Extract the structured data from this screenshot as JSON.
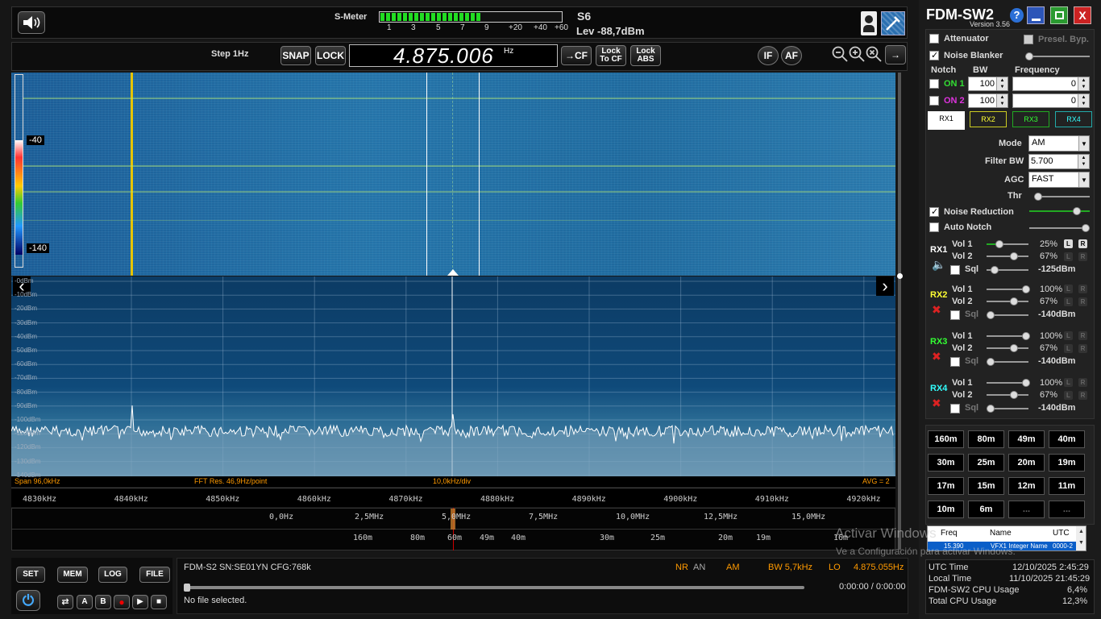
{
  "smeter": {
    "label": "S-Meter",
    "scale": [
      "1",
      "3",
      "5",
      "7",
      "9",
      "+20",
      "+40",
      "+60"
    ],
    "s_value": "S6",
    "level": "Lev -88,7dBm",
    "fill_fraction": 0.55
  },
  "toolbar": {
    "step": "Step 1Hz",
    "snap": "SNAP",
    "lock": "LOCK",
    "frequency": "4.875.006",
    "freq_unit": "Hz",
    "cf": "CF",
    "lock_to_cf": "Lock To CF",
    "lock_abs": "Lock ABS",
    "if": "IF",
    "af": "AF"
  },
  "waterfall": {
    "scale_top": "-40",
    "scale_bottom": "-140"
  },
  "spectrum": {
    "db_labels": [
      "-0dBm",
      "-10dBm",
      "-20dBm",
      "-30dBm",
      "-40dBm",
      "-50dBm",
      "-60dBm",
      "-70dBm",
      "-80dBm",
      "-90dBm",
      "-100dBm",
      "-110dBm",
      "-120dBm",
      "-130dBm",
      "-140dBm"
    ],
    "span": "Span 96,0kHz",
    "fft_res": "FFT Res. 46,9Hz/point",
    "div": "10,0kHz/div",
    "avg": "AVG = 2"
  },
  "freq_scale": [
    "4830kHz",
    "4840kHz",
    "4850kHz",
    "4860kHz",
    "4870kHz",
    "4880kHz",
    "4890kHz",
    "4900kHz",
    "4910kHz",
    "4920kHz"
  ],
  "hz_scale": [
    "0,0Hz",
    "2,5MHz",
    "5,0MHz",
    "7,5MHz",
    "10,0MHz",
    "12,5MHz",
    "15,0MHz"
  ],
  "band_scale": [
    "160m",
    "80m",
    "60m",
    "49m",
    "40m",
    "30m",
    "25m",
    "20m",
    "19m",
    "16m"
  ],
  "bottom_buttons": {
    "set": "SET",
    "mem": "MEM",
    "log": "LOG",
    "file": "FILE",
    "a": "A",
    "b": "B"
  },
  "status": {
    "device": "FDM-S2  SN:SE01YN  CFG:768k",
    "nr": "NR",
    "an": "AN",
    "mode": "AM",
    "bw": "BW 5,7kHz",
    "lo": "LO",
    "lo_freq": "4.875.055Hz",
    "file": "No file selected.",
    "time": "0:00:00 / 0:00:00"
  },
  "app": {
    "title": "FDM-SW2",
    "version": "Version 3.56"
  },
  "panel": {
    "attenuator": "Attenuator",
    "presel": "Presel. Byp.",
    "noise_blanker": "Noise Blanker",
    "notch": "Notch",
    "bw": "BW",
    "frequency": "Frequency",
    "on1": "ON 1",
    "on2": "ON 2",
    "n1_bw": "100",
    "n2_bw": "100",
    "n1_freq": "0",
    "n2_freq": "0",
    "rx_tabs": [
      "RX1",
      "RX2",
      "RX3",
      "RX4"
    ],
    "mode_label": "Mode",
    "mode_value": "AM",
    "filter_bw_label": "Filter BW",
    "filter_bw_value": "5.700",
    "agc_label": "AGC",
    "agc_value": "FAST",
    "thr_label": "Thr",
    "noise_reduction": "Noise Reduction",
    "auto_notch": "Auto Notch"
  },
  "rx": [
    {
      "name": "RX1",
      "vol1": "Vol 1",
      "vol1_val": "25%",
      "vol2": "Vol 2",
      "vol2_val": "67%",
      "sql": "Sql",
      "sql_val": "-125dBm",
      "color": "#ffffff"
    },
    {
      "name": "RX2",
      "vol1": "Vol 1",
      "vol1_val": "100%",
      "vol2": "Vol 2",
      "vol2_val": "67%",
      "sql": "Sql",
      "sql_val": "-140dBm",
      "color": "#ffff33"
    },
    {
      "name": "RX3",
      "vol1": "Vol 1",
      "vol1_val": "100%",
      "vol2": "Vol 2",
      "vol2_val": "67%",
      "sql": "Sql",
      "sql_val": "-140dBm",
      "color": "#33ff33"
    },
    {
      "name": "RX4",
      "vol1": "Vol 1",
      "vol1_val": "100%",
      "vol2": "Vol 2",
      "vol2_val": "67%",
      "sql": "Sql",
      "sql_val": "-140dBm",
      "color": "#33ffff"
    }
  ],
  "lr": {
    "l": "L",
    "r": "R"
  },
  "bands": [
    "160m",
    "80m",
    "49m",
    "40m",
    "30m",
    "25m",
    "20m",
    "19m",
    "17m",
    "15m",
    "12m",
    "11m",
    "10m",
    "6m",
    "...",
    "..."
  ],
  "memlist": {
    "freq": "Freq",
    "name": "Name",
    "utc": "UTC",
    "row_freq": "15.390",
    "row_name": "VFX1 Integer Name",
    "row_utc": "0000-2"
  },
  "activation": {
    "title": "Activar Windows",
    "subtitle": "Ve a Configuración para activar Windows."
  },
  "clock": {
    "utc_label": "UTC Time",
    "utc_value": "12/10/2025 2:45:29",
    "local_label": "Local Time",
    "local_value": "11/10/2025 21:45:29",
    "cpu_label": "FDM-SW2 CPU Usage",
    "cpu_value": "6,4%",
    "total_label": "Total CPU Usage",
    "total_value": "12,3%"
  }
}
